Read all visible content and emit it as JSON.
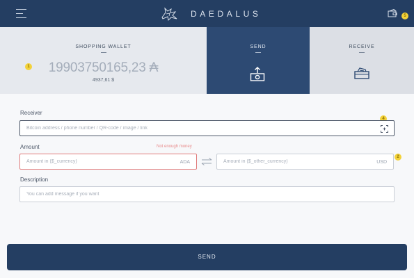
{
  "app": {
    "brand": "DAEDALUS"
  },
  "icons": {
    "menu": "hamburger-menu-icon",
    "logo": "daedalus-logo-icon",
    "wallets": "wallets-icon",
    "send": "send-money-icon",
    "receive": "receive-money-icon",
    "scan": "qr-scan-icon",
    "swap": "swap-arrows-icon"
  },
  "badges": {
    "top": "5",
    "balance": "1",
    "qr": "4",
    "usd_field": "2"
  },
  "wallet": {
    "name": "SHOPPING WALLET",
    "balance": "19903750165,23",
    "currency_symbol": "₳",
    "usd_value": "4937,61 $"
  },
  "tabs": {
    "send": "SEND",
    "receive": "RECEIVE"
  },
  "form": {
    "receiver_label": "Receiver",
    "receiver_placeholder": "Bitcoin address / phone number / QR-code / image / link",
    "amount_label": "Amount",
    "amount_error": "Not enough money",
    "amount_placeholder": "Amount in ($_currency)",
    "amount_suffix": "ADA",
    "other_placeholder": "Amount in ($_other_currency)",
    "other_suffix": "USD",
    "description_label": "Description",
    "description_placeholder": "You can add message if you want"
  },
  "send_button": "SEND",
  "colors": {
    "navbar": "#243e62",
    "active_tab": "#2d4a73",
    "error": "#e07a7a",
    "badge": "#f3d23a"
  }
}
